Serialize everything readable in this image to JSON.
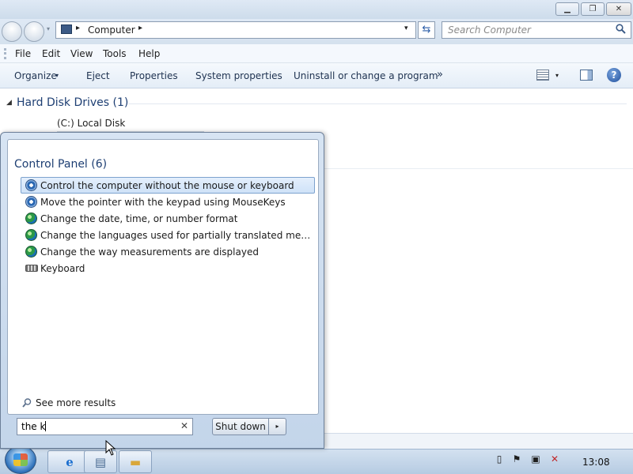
{
  "window": {
    "minimize_glyph": "▁",
    "maximize_glyph": "❐",
    "close_glyph": "✕"
  },
  "navigation": {
    "address": "Computer",
    "address_separator": "▸",
    "dropdown_glyph": "▾",
    "refresh_glyph": "⇆",
    "history_glyph": "▾"
  },
  "search": {
    "placeholder": "Search Computer",
    "icon": "magnifier-icon"
  },
  "menubar": {
    "items": [
      "File",
      "Edit",
      "View",
      "Tools",
      "Help"
    ]
  },
  "toolbar": {
    "items": [
      "Organize",
      "Eject",
      "Properties",
      "System properties",
      "Uninstall or change a program"
    ],
    "organize_arrow": "▾",
    "more_glyph": "»",
    "views_arrow": "▾",
    "help_glyph": "?"
  },
  "content": {
    "group_header": "Hard Disk Drives (1)",
    "group_arrow": "◢",
    "drive_label": "(C:) Local Disk"
  },
  "start_menu": {
    "results_header": "Control Panel (6)",
    "results": [
      {
        "label": "Control the computer without the mouse or keyboard",
        "icon": "ease-of-access-icon",
        "selected": true
      },
      {
        "label": "Move the pointer with the keypad using MouseKeys",
        "icon": "ease-of-access-icon",
        "selected": false
      },
      {
        "label": "Change the date, time, or number format",
        "icon": "region-globe-icon",
        "selected": false
      },
      {
        "label": "Change the languages used for partially translated menus and ...",
        "icon": "region-globe-icon",
        "selected": false
      },
      {
        "label": "Change the way measurements are displayed",
        "icon": "region-globe-icon",
        "selected": false
      },
      {
        "label": "Keyboard",
        "icon": "keyboard-icon",
        "selected": false
      }
    ],
    "see_more": "See more results",
    "search_value": "the k",
    "clear_glyph": "✕",
    "shutdown_label": "Shut down",
    "shutdown_arrow": "▸"
  },
  "taskbar": {
    "ie_glyph": "e",
    "explorer_glyph": "▤",
    "folder_glyph": "▬",
    "clock": "13:08"
  },
  "colors": {
    "accent": "#1e3f73",
    "selection": "#cfe2f8",
    "taskbar": "#b6cbe2"
  }
}
